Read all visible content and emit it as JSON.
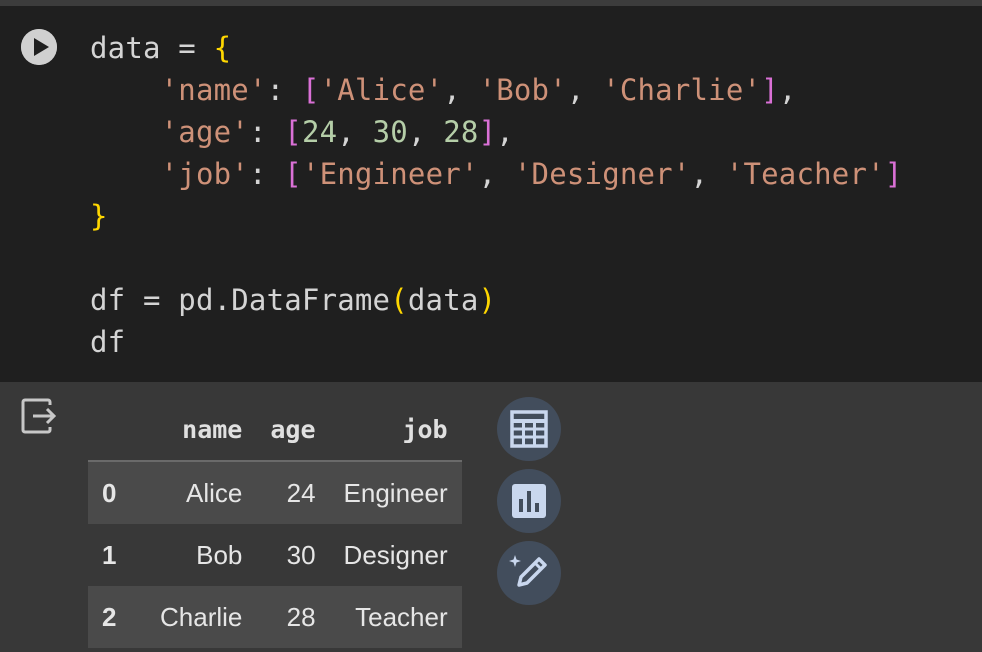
{
  "code": {
    "lines": [
      [
        "data = ",
        "{"
      ],
      [
        "'name'",
        ": ",
        "[",
        "'Alice'",
        ", ",
        "'Bob'",
        ", ",
        "'Charlie'",
        "]",
        ","
      ],
      [
        "'age'",
        ": ",
        "[",
        "24",
        ", ",
        "30",
        ", ",
        "28",
        "]",
        ","
      ],
      [
        "'job'",
        ": ",
        "[",
        "'Engineer'",
        ", ",
        "'Designer'",
        ", ",
        "'Teacher'",
        "]"
      ],
      [
        "}"
      ],
      [
        "df = pd.DataFrame",
        "(",
        "data",
        ")"
      ],
      [
        "df"
      ]
    ]
  },
  "table": {
    "columns": [
      "name",
      "age",
      "job"
    ],
    "rows": [
      {
        "index": "0",
        "name": "Alice",
        "age": "24",
        "job": "Engineer"
      },
      {
        "index": "1",
        "name": "Bob",
        "age": "30",
        "job": "Designer"
      },
      {
        "index": "2",
        "name": "Charlie",
        "age": "28",
        "job": "Teacher"
      }
    ]
  },
  "icons": {
    "run": "play-circle-icon",
    "output": "output-exit-icon",
    "table_view": "table-grid-icon",
    "chart": "bar-chart-icon",
    "magic": "magic-wand-pen-icon"
  },
  "colors": {
    "string": "#ce9178",
    "number": "#b5cea8",
    "brace": "#ffd700",
    "bracket": "#da70d6",
    "side_button": "#424d5c"
  }
}
